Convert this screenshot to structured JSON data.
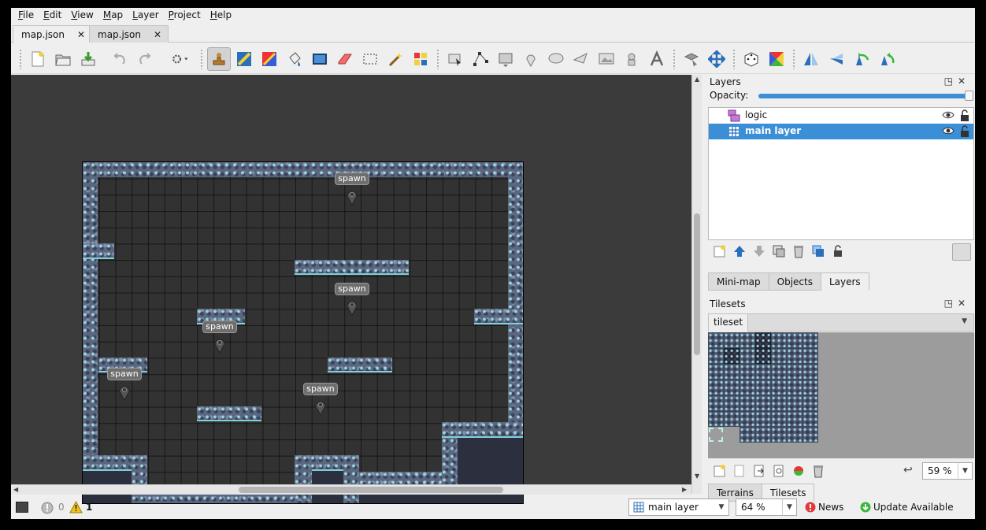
{
  "menubar": {
    "items": [
      "File",
      "Edit",
      "View",
      "Map",
      "Layer",
      "Project",
      "Help"
    ]
  },
  "tabs": [
    {
      "label": "map.json",
      "active": true
    },
    {
      "label": "map.json",
      "active": false
    }
  ],
  "toolbar": {
    "groups": [
      "file",
      "history",
      "commands",
      "tools",
      "transform"
    ],
    "icons": [
      "new-map-icon",
      "open-icon",
      "save-icon",
      "undo-icon",
      "redo-icon",
      "commands-icon",
      "stamp-brush-icon",
      "terrain-brush-icon",
      "wang-brush-icon",
      "bucket-fill-icon",
      "shape-fill-icon",
      "eraser-icon",
      "rect-select-icon",
      "magic-wand-icon",
      "select-same-tile-icon",
      "select-objects-icon",
      "edit-polygons-icon",
      "insert-rectangle-icon",
      "insert-point-icon",
      "insert-ellipse-icon",
      "insert-polygon-icon",
      "insert-tile-icon",
      "insert-template-icon",
      "insert-text-icon",
      "layer-select-icon",
      "layer-offset-icon",
      "random-mode-icon",
      "wang-fill-icon",
      "flip-horizontal-icon",
      "flip-vertical-icon",
      "rotate-left-icon",
      "rotate-right-icon"
    ]
  },
  "map": {
    "spawn_label": "spawn",
    "spawn_count": 5
  },
  "layers_panel": {
    "title": "Layers",
    "opacity_label": "Opacity:",
    "opacity_value": 1.0,
    "layers": [
      {
        "name": "logic",
        "type": "object-layer",
        "selected": false
      },
      {
        "name": "main layer",
        "type": "tile-layer",
        "selected": true
      }
    ],
    "bottom_tabs": [
      "Mini-map",
      "Objects",
      "Layers"
    ],
    "active_tab": "Layers"
  },
  "tilesets_panel": {
    "title": "Tilesets",
    "tab": "tileset",
    "zoom": "59 %",
    "bottom_tabs": [
      "Terrains",
      "Tilesets"
    ],
    "active_tab": "Tilesets"
  },
  "statusbar": {
    "error_count": "0",
    "warning_count": "1",
    "layer_select": "main layer",
    "zoom": "64 %",
    "news": "News",
    "update": "Update Available"
  },
  "colors": {
    "selection": "#3b8fd6",
    "map_background": "#3b3b3b",
    "wall": "#5a6780",
    "accent_tile": "#9fd3dc"
  }
}
